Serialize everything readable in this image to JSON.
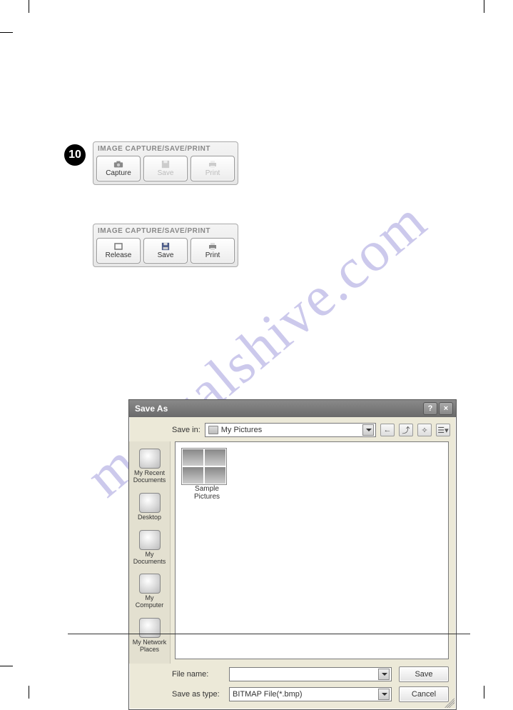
{
  "step_number": "10",
  "toolbar1": {
    "title": "IMAGE CAPTURE/SAVE/PRINT",
    "btn1": "Capture",
    "btn2": "Save",
    "btn3": "Print"
  },
  "toolbar2": {
    "title": "IMAGE CAPTURE/SAVE/PRINT",
    "btn1": "Release",
    "btn2": "Save",
    "btn3": "Print"
  },
  "saveas": {
    "title": "Save As",
    "savein_label": "Save in:",
    "savein_value": "My Pictures",
    "places": {
      "recent": "My Recent Documents",
      "desktop": "Desktop",
      "mydocs": "My Documents",
      "mycomp": "My Computer",
      "mynet": "My Network Places"
    },
    "thumb_label": "Sample Pictures",
    "filename_label": "File name:",
    "filename_value": "",
    "saveastype_label": "Save as type:",
    "saveastype_value": "BITMAP File(*.bmp)",
    "save_btn": "Save",
    "cancel_btn": "Cancel"
  },
  "watermark": "manualshive.com"
}
